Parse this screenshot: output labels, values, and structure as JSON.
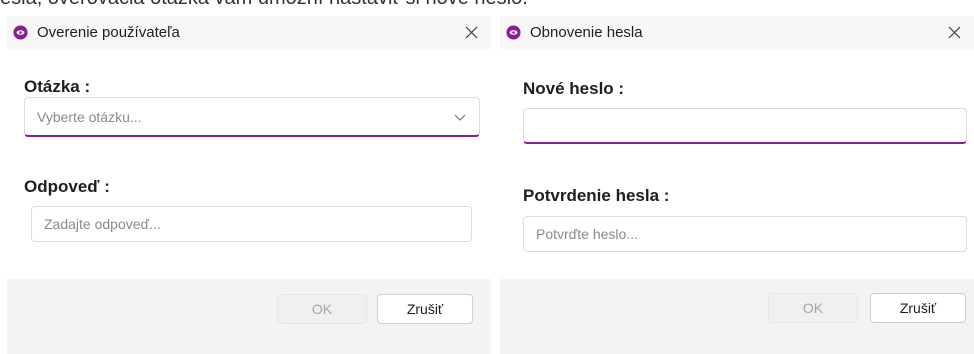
{
  "top_caption": "esla, overovacia otázka vám umožní nastaviť si nové heslo.",
  "colors": {
    "accent": "#8d1d8e"
  },
  "dialog_left": {
    "title": "Overenie používateľa",
    "icon": "app-eye-icon",
    "question_label": "Otázka :",
    "question_placeholder": "Vyberte otázku...",
    "answer_label": "Odpoveď :",
    "answer_placeholder": "Zadajte odpoveď...",
    "ok_label": "OK",
    "cancel_label": "Zrušiť"
  },
  "dialog_right": {
    "title": "Obnovenie hesla",
    "icon": "app-eye-icon",
    "new_password_label": "Nové heslo :",
    "new_password_value": "",
    "confirm_label": "Potvrdenie hesla :",
    "confirm_placeholder": "Potvrďte heslo...",
    "ok_label": "OK",
    "cancel_label": "Zrušiť"
  }
}
